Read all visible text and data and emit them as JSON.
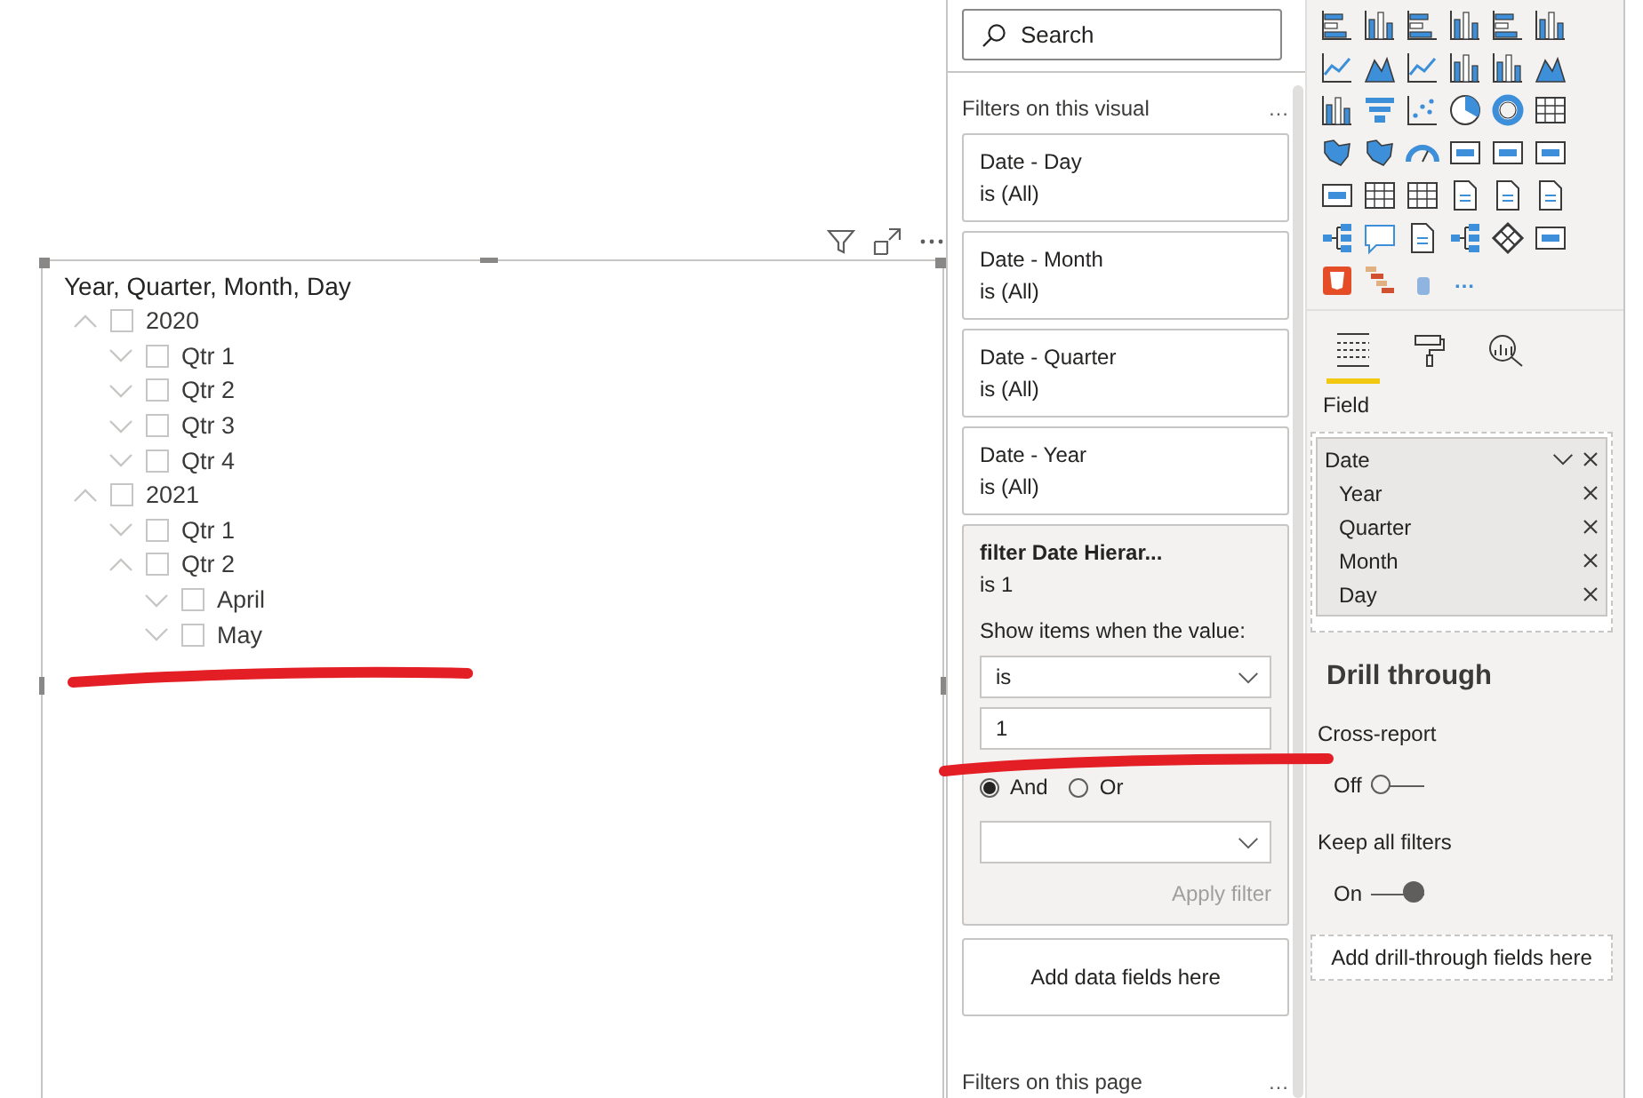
{
  "visual": {
    "title": "Year, Quarter, Month, Day",
    "tree": [
      {
        "label": "2020",
        "expanded": true,
        "checked": false,
        "children": [
          {
            "label": "Qtr 1",
            "expanded": false,
            "checked": false
          },
          {
            "label": "Qtr 2",
            "expanded": false,
            "checked": false
          },
          {
            "label": "Qtr 3",
            "expanded": false,
            "checked": false
          },
          {
            "label": "Qtr 4",
            "expanded": false,
            "checked": false
          }
        ]
      },
      {
        "label": "2021",
        "expanded": true,
        "checked": false,
        "children": [
          {
            "label": "Qtr 1",
            "expanded": false,
            "checked": false
          },
          {
            "label": "Qtr 2",
            "expanded": true,
            "checked": false,
            "children": [
              {
                "label": "April",
                "expanded": false,
                "checked": false
              },
              {
                "label": "May",
                "expanded": false,
                "checked": false
              }
            ]
          }
        ]
      }
    ]
  },
  "filter_pane": {
    "search": {
      "placeholder": "Search"
    },
    "visual_section": {
      "title": "Filters on this visual",
      "more": "…"
    },
    "filters": [
      {
        "kind": "summary",
        "name": "Date - Day",
        "state": "is (All)"
      },
      {
        "kind": "summary",
        "name": "Date - Month",
        "state": "is (All)"
      },
      {
        "kind": "summary",
        "name": "Date - Quarter",
        "state": "is (All)"
      },
      {
        "kind": "summary",
        "name": "Date - Year",
        "state": "is (All)"
      },
      {
        "kind": "expanded",
        "name": "filter Date Hierar...",
        "state": "is 1",
        "show_label": "Show items when the value:",
        "operator": "is",
        "value": "1",
        "logic": [
          {
            "label": "And",
            "selected": true
          },
          {
            "label": "Or",
            "selected": false
          }
        ],
        "apply": "Apply filter",
        "apply_disabled": true
      }
    ],
    "add_fields": "Add data fields here",
    "page_section": {
      "title": "Filters on this page",
      "more": "…"
    }
  },
  "viz_pane": {
    "more": "…",
    "tabs": [
      {
        "kind": "fields",
        "selected": true
      },
      {
        "kind": "format",
        "selected": false
      },
      {
        "kind": "analytics",
        "selected": false
      }
    ],
    "field_label": "Field",
    "field_well": {
      "name": "Date",
      "fields": [
        "Year",
        "Quarter",
        "Month",
        "Day"
      ]
    },
    "drill_through": {
      "title": "Drill through",
      "options": [
        {
          "label": "Cross-report",
          "state": "Off",
          "on": false
        },
        {
          "label": "Keep all filters",
          "state": "On",
          "on": true
        }
      ],
      "drop": "Add drill-through fields here"
    }
  },
  "annotations": [
    {
      "kind": "stroke",
      "color": "#e31e24"
    },
    {
      "kind": "stroke",
      "color": "#e31e24"
    }
  ]
}
